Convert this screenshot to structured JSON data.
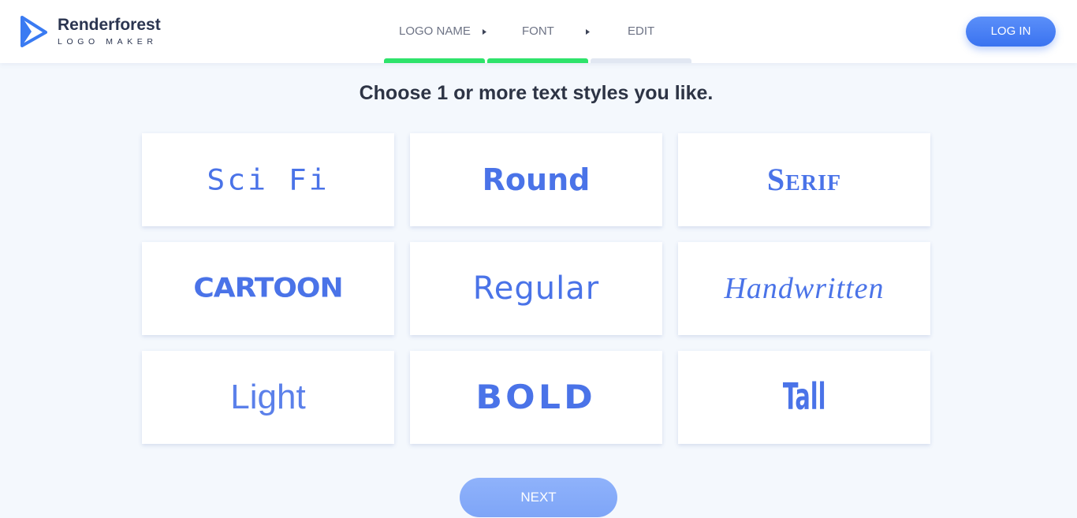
{
  "brand": {
    "name": "Renderforest",
    "subtitle": "LOGO MAKER",
    "accent": "#2f6bf5"
  },
  "steps": [
    {
      "label": "LOGO NAME",
      "status": "done"
    },
    {
      "label": "FONT",
      "status": "done"
    },
    {
      "label": "EDIT",
      "status": "todo"
    }
  ],
  "header": {
    "login_label": "LOG IN"
  },
  "main": {
    "heading": "Choose 1 or more text styles you like.",
    "styles": [
      {
        "label": "Sci Fi"
      },
      {
        "label": "Round"
      },
      {
        "label": "Serif"
      },
      {
        "label": "CARTOON"
      },
      {
        "label": "Regular"
      },
      {
        "label": "Handwritten"
      },
      {
        "label": "Light"
      },
      {
        "label": "BOLD"
      },
      {
        "label": "Tall"
      }
    ],
    "next_label": "NEXT"
  },
  "colors": {
    "card_text": "#4a73e8",
    "progress_done": "#2ee36b",
    "progress_todo": "#e1e7f2",
    "button": "#3a73f0"
  }
}
